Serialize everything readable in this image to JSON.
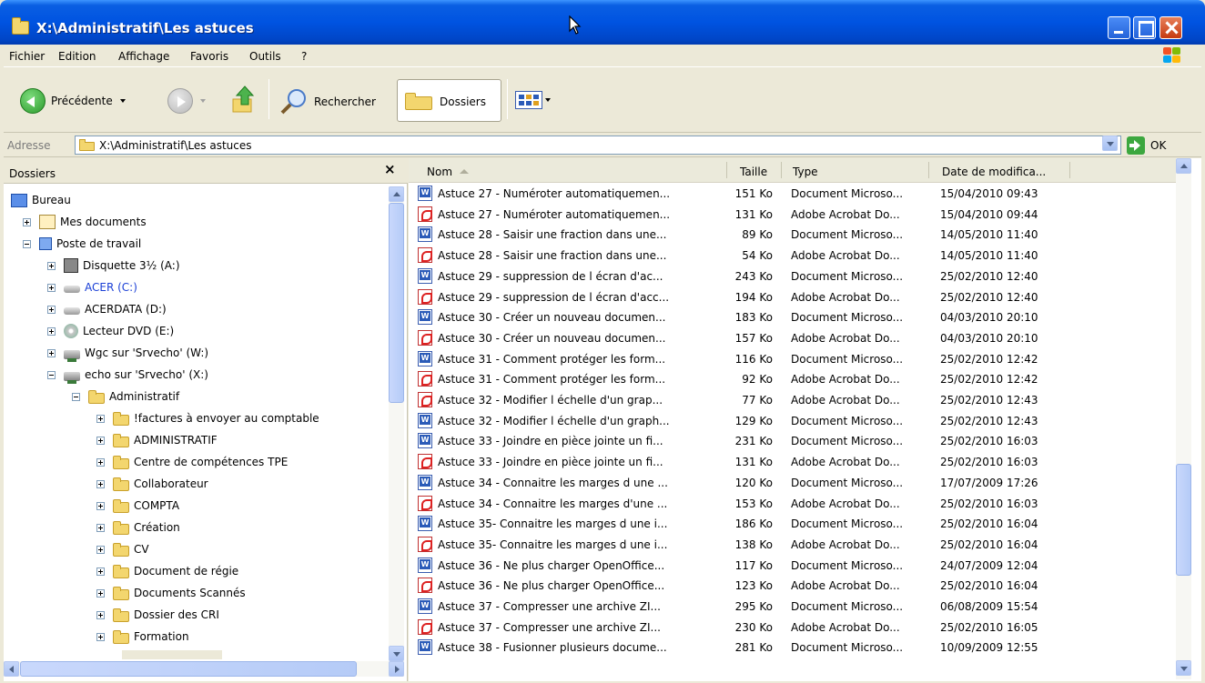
{
  "window": {
    "title": "X:\\Administratif\\Les astuces"
  },
  "menu": {
    "items": [
      "Fichier",
      "Edition",
      "Affichage",
      "Favoris",
      "Outils",
      "?"
    ]
  },
  "toolbar": {
    "back_label": "Précédente",
    "search_label": "Rechercher",
    "folders_label": "Dossiers"
  },
  "address": {
    "label": "Adresse",
    "value": "X:\\Administratif\\Les astuces",
    "go_label": "OK"
  },
  "folders_pane": {
    "title": "Dossiers",
    "tree": [
      {
        "label": "Bureau",
        "icon": "desktop-icon"
      },
      {
        "label": "Mes documents",
        "icon": "my-documents-icon"
      },
      {
        "label": "Poste de travail",
        "icon": "my-computer-icon"
      },
      {
        "label": "Disquette 3½ (A:)",
        "icon": "floppy-icon"
      },
      {
        "label": "ACER (C:)",
        "icon": "drive-icon",
        "color": "#1a3fd6"
      },
      {
        "label": "ACERDATA (D:)",
        "icon": "drive-icon"
      },
      {
        "label": "Lecteur DVD (E:)",
        "icon": "dvd-icon"
      },
      {
        "label": "Wgc sur 'Srvecho' (W:)",
        "icon": "network-drive-icon"
      },
      {
        "label": "echo sur 'Srvecho' (X:)",
        "icon": "network-drive-icon"
      },
      {
        "label": "Administratif",
        "icon": "folder-open-icon"
      },
      {
        "label": "!factures à envoyer au comptable",
        "icon": "folder-icon"
      },
      {
        "label": "ADMINISTRATIF",
        "icon": "folder-icon"
      },
      {
        "label": "Centre de compétences TPE",
        "icon": "folder-icon"
      },
      {
        "label": "Collaborateur",
        "icon": "folder-icon"
      },
      {
        "label": "COMPTA",
        "icon": "folder-icon"
      },
      {
        "label": "Création",
        "icon": "folder-icon"
      },
      {
        "label": "CV",
        "icon": "folder-icon"
      },
      {
        "label": "Document de régie",
        "icon": "folder-icon"
      },
      {
        "label": "Documents Scannés",
        "icon": "folder-icon"
      },
      {
        "label": "Dossier des CRI",
        "icon": "folder-icon"
      },
      {
        "label": "Formation",
        "icon": "folder-icon"
      }
    ]
  },
  "file_list": {
    "columns": [
      "Nom",
      "Taille",
      "Type",
      "Date de modifica..."
    ],
    "rows": [
      {
        "name": "Astuce 27 - Numéroter automatiquemen...",
        "size": "151 Ko",
        "type": "Document Microso...",
        "date": "15/04/2010 09:43",
        "icon": "word"
      },
      {
        "name": "Astuce 27 - Numéroter automatiquemen...",
        "size": "131 Ko",
        "type": "Adobe Acrobat Do...",
        "date": "15/04/2010 09:44",
        "icon": "pdf"
      },
      {
        "name": "Astuce 28 - Saisir une fraction dans une...",
        "size": "89 Ko",
        "type": "Document Microso...",
        "date": "14/05/2010 11:40",
        "icon": "word"
      },
      {
        "name": "Astuce 28 - Saisir une fraction dans une...",
        "size": "54 Ko",
        "type": "Adobe Acrobat Do...",
        "date": "14/05/2010 11:40",
        "icon": "pdf"
      },
      {
        "name": "Astuce 29 - suppression de  l écran d'ac...",
        "size": "243 Ko",
        "type": "Document Microso...",
        "date": "25/02/2010 12:40",
        "icon": "word"
      },
      {
        "name": "Astuce 29 - suppression de l écran d'acc...",
        "size": "194 Ko",
        "type": "Adobe Acrobat Do...",
        "date": "25/02/2010 12:40",
        "icon": "pdf"
      },
      {
        "name": "Astuce 30 - Créer un nouveau documen...",
        "size": "183 Ko",
        "type": "Document Microso...",
        "date": "04/03/2010 20:10",
        "icon": "word"
      },
      {
        "name": "Astuce 30 - Créer un nouveau documen...",
        "size": "157 Ko",
        "type": "Adobe Acrobat Do...",
        "date": "04/03/2010 20:10",
        "icon": "pdf"
      },
      {
        "name": "Astuce 31 - Comment protéger les form...",
        "size": "116 Ko",
        "type": "Document Microso...",
        "date": "25/02/2010 12:42",
        "icon": "word"
      },
      {
        "name": "Astuce 31 - Comment protéger les form...",
        "size": "92 Ko",
        "type": "Adobe Acrobat Do...",
        "date": "25/02/2010 12:42",
        "icon": "pdf"
      },
      {
        "name": "Astuce 32 - Modifier  l échelle d'un grap...",
        "size": "77 Ko",
        "type": "Adobe Acrobat Do...",
        "date": "25/02/2010 12:43",
        "icon": "pdf"
      },
      {
        "name": "Astuce 32 - Modifier l échelle d'un graph...",
        "size": "129 Ko",
        "type": "Document Microso...",
        "date": "25/02/2010 12:43",
        "icon": "word"
      },
      {
        "name": "Astuce 33 - Joindre en pièce jointe un fi...",
        "size": "231 Ko",
        "type": "Document Microso...",
        "date": "25/02/2010 16:03",
        "icon": "word"
      },
      {
        "name": "Astuce 33 - Joindre en pièce jointe un fi...",
        "size": "131 Ko",
        "type": "Adobe Acrobat Do...",
        "date": "25/02/2010 16:03",
        "icon": "pdf"
      },
      {
        "name": "Astuce 34 - Connaitre les marges d une ...",
        "size": "120 Ko",
        "type": "Document Microso...",
        "date": "17/07/2009 17:26",
        "icon": "word"
      },
      {
        "name": "Astuce 34 - Connaitre les marges d'une ...",
        "size": "153 Ko",
        "type": "Adobe Acrobat Do...",
        "date": "25/02/2010 16:03",
        "icon": "pdf"
      },
      {
        "name": "Astuce 35- Connaitre les marges d une i...",
        "size": "186 Ko",
        "type": "Document Microso...",
        "date": "25/02/2010 16:04",
        "icon": "word"
      },
      {
        "name": "Astuce 35- Connaitre les marges d une i...",
        "size": "138 Ko",
        "type": "Adobe Acrobat Do...",
        "date": "25/02/2010 16:04",
        "icon": "pdf"
      },
      {
        "name": "Astuce 36 - Ne plus charger OpenOffice...",
        "size": "117 Ko",
        "type": "Document Microso...",
        "date": "24/07/2009 12:04",
        "icon": "word"
      },
      {
        "name": "Astuce 36 - Ne plus charger OpenOffice...",
        "size": "123 Ko",
        "type": "Adobe Acrobat Do...",
        "date": "25/02/2010 16:04",
        "icon": "pdf"
      },
      {
        "name": "Astuce 37 - Compresser une archive ZI...",
        "size": "295 Ko",
        "type": "Document Microso...",
        "date": "06/08/2009 15:54",
        "icon": "word"
      },
      {
        "name": "Astuce 37 - Compresser une archive ZI...",
        "size": "230 Ko",
        "type": "Adobe Acrobat Do...",
        "date": "25/02/2010 16:05",
        "icon": "pdf"
      },
      {
        "name": "Astuce 38 - Fusionner plusieurs docume...",
        "size": "281 Ko",
        "type": "Document Microso...",
        "date": "10/09/2009 12:55",
        "icon": "word"
      }
    ]
  }
}
